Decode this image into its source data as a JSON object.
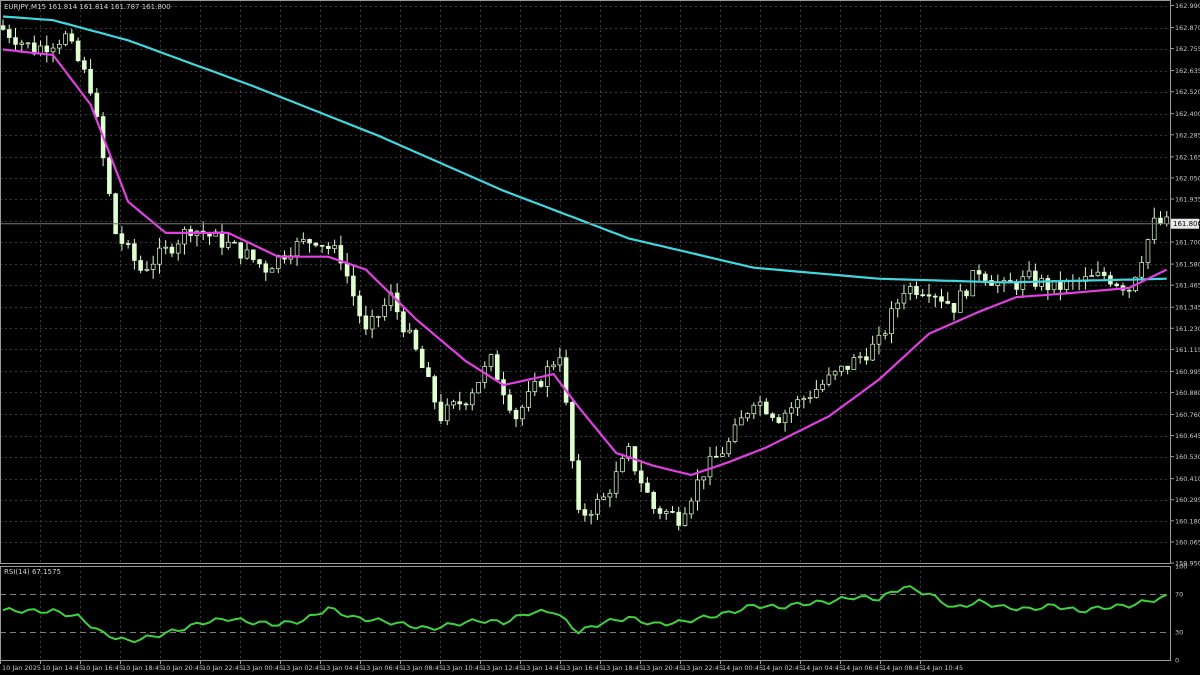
{
  "header": {
    "symbol_label": "EURJPY,M15  161.814 161.814 161.787 161.800"
  },
  "rsi_header": {
    "label": "RSI(14) 67.1575"
  },
  "current_price_label": "161.800",
  "colors": {
    "background": "#000000",
    "grid": "#3a3a3a",
    "axis_text": "#c8c8c8",
    "frame": "#9a9a9a",
    "candle_bull_body": "#000000",
    "candle_bull_border": "#dfffcf",
    "candle_bear_body": "#dfffcf",
    "ma_fast": "#e040e0",
    "ma_slow": "#40d8e0",
    "rsi_line": "#40d040",
    "level_line": "#808080"
  },
  "chart_data": [
    {
      "type": "candlestick",
      "title": "EURJPY,M15",
      "yticks": [
        162.99,
        162.87,
        162.755,
        162.635,
        162.52,
        162.4,
        162.285,
        162.165,
        162.05,
        161.935,
        161.815,
        161.7,
        161.58,
        161.465,
        161.345,
        161.23,
        161.115,
        160.995,
        160.88,
        160.76,
        160.645,
        160.53,
        160.41,
        160.295,
        160.18,
        160.065,
        159.95
      ],
      "ylim": [
        159.95,
        163.02
      ],
      "x_tick_labels": [
        "10 Jan 2025",
        "10 Jan 14:45",
        "10 Jan 16:45",
        "10 Jan 18:45",
        "10 Jan 20:45",
        "10 Jan 22:45",
        "13 Jan 00:45",
        "13 Jan 02:45",
        "13 Jan 04:45",
        "13 Jan 06:45",
        "13 Jan 08:45",
        "13 Jan 10:45",
        "13 Jan 12:45",
        "13 Jan 14:45",
        "13 Jan 16:45",
        "13 Jan 18:45",
        "13 Jan 20:45",
        "13 Jan 22:45",
        "14 Jan 00:45",
        "14 Jan 02:45",
        "14 Jan 04:45",
        "14 Jan 06:45",
        "14 Jan 08:45",
        "14 Jan 10:45"
      ],
      "close_path_keypoints": [
        [
          0,
          162.86
        ],
        [
          5,
          162.75
        ],
        [
          10,
          162.82
        ],
        [
          14,
          162.55
        ],
        [
          18,
          161.75
        ],
        [
          22,
          161.55
        ],
        [
          26,
          161.65
        ],
        [
          30,
          161.78
        ],
        [
          34,
          161.72
        ],
        [
          38,
          161.65
        ],
        [
          42,
          161.56
        ],
        [
          46,
          161.67
        ],
        [
          50,
          161.72
        ],
        [
          54,
          161.62
        ],
        [
          58,
          161.2
        ],
        [
          62,
          161.4
        ],
        [
          66,
          161.1
        ],
        [
          70,
          160.75
        ],
        [
          74,
          160.85
        ],
        [
          78,
          161.05
        ],
        [
          82,
          160.75
        ],
        [
          86,
          160.95
        ],
        [
          89,
          161.1
        ],
        [
          92,
          160.2
        ],
        [
          96,
          160.3
        ],
        [
          100,
          160.55
        ],
        [
          104,
          160.25
        ],
        [
          108,
          160.2
        ],
        [
          112,
          160.45
        ],
        [
          116,
          160.6
        ],
        [
          120,
          160.85
        ],
        [
          124,
          160.75
        ],
        [
          128,
          160.85
        ],
        [
          132,
          160.95
        ],
        [
          136,
          161.05
        ],
        [
          140,
          161.15
        ],
        [
          144,
          161.45
        ],
        [
          148,
          161.45
        ],
        [
          152,
          161.35
        ],
        [
          156,
          161.55
        ],
        [
          160,
          161.45
        ],
        [
          164,
          161.5
        ],
        [
          168,
          161.45
        ],
        [
          172,
          161.48
        ],
        [
          176,
          161.52
        ],
        [
          180,
          161.45
        ],
        [
          184,
          161.8
        ]
      ],
      "ma_fast_keypoints": [
        [
          0,
          162.75
        ],
        [
          8,
          162.72
        ],
        [
          14,
          162.45
        ],
        [
          20,
          161.92
        ],
        [
          26,
          161.75
        ],
        [
          36,
          161.75
        ],
        [
          44,
          161.62
        ],
        [
          52,
          161.62
        ],
        [
          58,
          161.55
        ],
        [
          66,
          161.28
        ],
        [
          74,
          161.05
        ],
        [
          80,
          160.92
        ],
        [
          88,
          160.98
        ],
        [
          92,
          160.8
        ],
        [
          98,
          160.55
        ],
        [
          104,
          160.48
        ],
        [
          110,
          160.43
        ],
        [
          116,
          160.5
        ],
        [
          122,
          160.58
        ],
        [
          132,
          160.75
        ],
        [
          140,
          160.95
        ],
        [
          148,
          161.2
        ],
        [
          156,
          161.32
        ],
        [
          162,
          161.4
        ],
        [
          170,
          161.42
        ],
        [
          180,
          161.45
        ],
        [
          186,
          161.55
        ]
      ],
      "ma_slow_keypoints": [
        [
          0,
          162.93
        ],
        [
          8,
          162.91
        ],
        [
          20,
          162.8
        ],
        [
          40,
          162.55
        ],
        [
          60,
          162.28
        ],
        [
          80,
          161.98
        ],
        [
          100,
          161.72
        ],
        [
          120,
          161.56
        ],
        [
          140,
          161.5
        ],
        [
          160,
          161.48
        ],
        [
          186,
          161.5
        ]
      ],
      "current_price": 161.8
    },
    {
      "type": "line",
      "title": "RSI(14) 67.1575",
      "yticks": [
        100,
        70,
        30,
        0
      ],
      "ylim": [
        0,
        100
      ],
      "levels": [
        70,
        30
      ],
      "rsi_keypoints": [
        [
          0,
          53
        ],
        [
          5,
          52
        ],
        [
          8,
          52
        ],
        [
          12,
          46
        ],
        [
          16,
          28
        ],
        [
          20,
          20
        ],
        [
          24,
          25
        ],
        [
          28,
          32
        ],
        [
          32,
          40
        ],
        [
          36,
          44
        ],
        [
          40,
          40
        ],
        [
          44,
          38
        ],
        [
          48,
          42
        ],
        [
          52,
          55
        ],
        [
          56,
          45
        ],
        [
          60,
          42
        ],
        [
          64,
          38
        ],
        [
          68,
          33
        ],
        [
          72,
          38
        ],
        [
          76,
          42
        ],
        [
          80,
          40
        ],
        [
          84,
          50
        ],
        [
          88,
          52
        ],
        [
          92,
          30
        ],
        [
          96,
          40
        ],
        [
          100,
          45
        ],
        [
          104,
          38
        ],
        [
          108,
          40
        ],
        [
          112,
          45
        ],
        [
          116,
          50
        ],
        [
          120,
          58
        ],
        [
          124,
          56
        ],
        [
          128,
          60
        ],
        [
          132,
          62
        ],
        [
          136,
          67
        ],
        [
          140,
          65
        ],
        [
          144,
          78
        ],
        [
          148,
          70
        ],
        [
          152,
          55
        ],
        [
          156,
          62
        ],
        [
          160,
          56
        ],
        [
          164,
          54
        ],
        [
          168,
          58
        ],
        [
          172,
          52
        ],
        [
          176,
          56
        ],
        [
          180,
          58
        ],
        [
          186,
          67.2
        ]
      ]
    }
  ]
}
